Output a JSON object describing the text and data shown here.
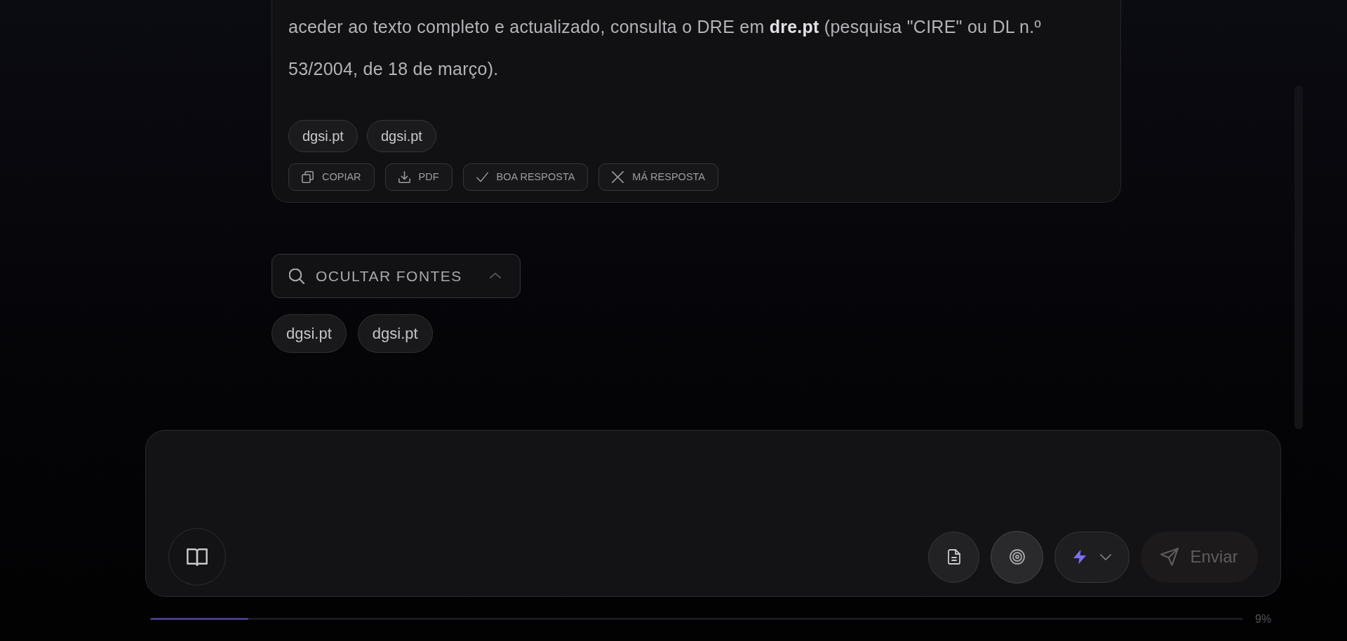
{
  "answer_card": {
    "paragraph": "aceder ao texto completo e actualizado, consulta o DRE em **dre.pt** (pesquisa \"CIRE\" ou DL n.º 53/2004, de 18 de março).",
    "source_chips": [
      "dgsi.pt",
      "dgsi.pt"
    ],
    "actions": [
      {
        "kind": "copy",
        "label": "COPIAR"
      },
      {
        "kind": "download",
        "label": "PDF"
      },
      {
        "kind": "good",
        "label": "BOA RESPOSTA"
      },
      {
        "kind": "bad",
        "label": "MÁ RESPOSTA"
      }
    ]
  },
  "sources_toggle": {
    "label": "OCULTAR FONTES",
    "expanded": true
  },
  "sources": [
    "dgsi.pt",
    "dgsi.pt"
  ],
  "composer": {
    "tools": [
      {
        "kind": "library"
      },
      {
        "kind": "document"
      },
      {
        "kind": "target"
      },
      {
        "kind": "model"
      }
    ],
    "send_button": {
      "label": "Enviar",
      "disabled": true
    }
  },
  "progress": {
    "level": 0.09,
    "reading": "9%"
  }
}
